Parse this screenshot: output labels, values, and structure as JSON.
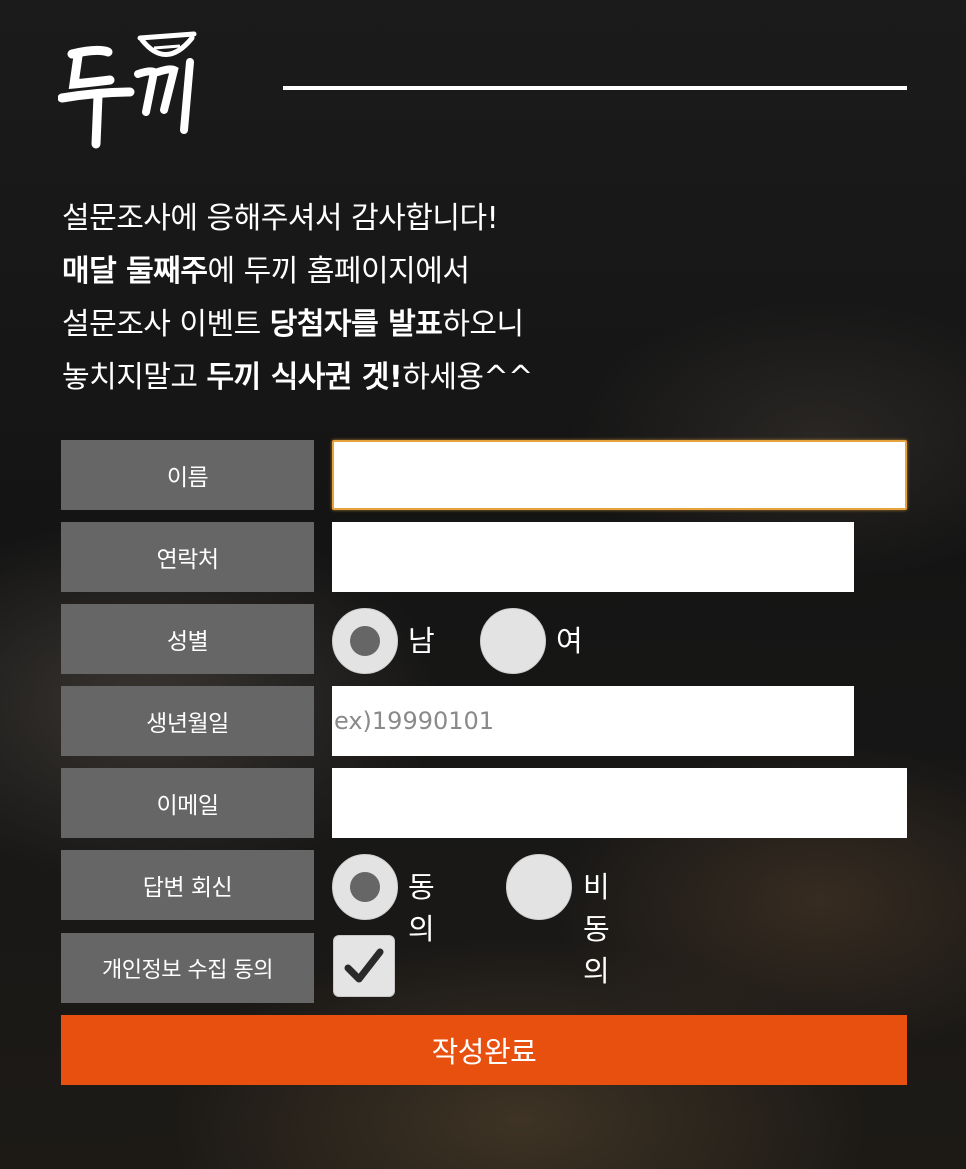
{
  "brand": {
    "logo_text": "두끼"
  },
  "intro": {
    "line1": "설문조사에 응해주셔서 감사합니다!",
    "line2_bold": "매달 둘째주",
    "line2_rest": "에 두끼 홈페이지에서",
    "line3_pre": "설문조사 이벤트 ",
    "line3_bold": "당첨자를 발표",
    "line3_post": "하오니",
    "line4_pre": "놓치지말고 ",
    "line4_bold": "두끼 식사권 겟!",
    "line4_post": "하세용^^"
  },
  "form": {
    "name": {
      "label": "이름",
      "value": ""
    },
    "contact": {
      "label": "연락처",
      "value": ""
    },
    "gender": {
      "label": "성별",
      "options": [
        "남",
        "여"
      ],
      "selected": "남"
    },
    "birth": {
      "label": "생년월일",
      "value": "",
      "placeholder": "ex)19990101"
    },
    "email": {
      "label": "이메일",
      "value": ""
    },
    "reply": {
      "label": "답변 회신",
      "options": [
        "동의",
        "비동의"
      ],
      "selected": "동의"
    },
    "privacy": {
      "label": "개인정보 수집 동의",
      "checked": true
    },
    "submit_label": "작성완료"
  },
  "colors": {
    "accent": "#e8500f",
    "label_bg": "#666666",
    "focus": "#e6a23c"
  }
}
